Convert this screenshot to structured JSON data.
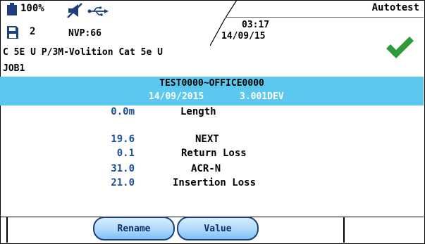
{
  "status": {
    "battery_percent": "100%",
    "memory_count": "2",
    "nvp": "NVP:66",
    "time": "03:17",
    "date": "14/09/15",
    "mode": "Autotest",
    "icons": [
      "battery-icon",
      "floppy-icon",
      "mute-icon",
      "usb-icon",
      "check-icon"
    ],
    "check_color": "#2e9b3a"
  },
  "cable_type": "C 5E U P/3M-Volition Cat 5e U",
  "job": "JOB1",
  "banner": {
    "title": "TEST0000~OFFICE0000",
    "date": "14/09/2015",
    "device": "3.001DEV",
    "color": "#5bc8f0"
  },
  "results": [
    {
      "value": "0.0m",
      "label": "Length"
    },
    {
      "value": "19.6",
      "label": "NEXT"
    },
    {
      "value": "0.1",
      "label": "Return Loss"
    },
    {
      "value": "31.0",
      "label": "ACR-N"
    },
    {
      "value": "21.0",
      "label": "Insertion Loss"
    }
  ],
  "softkeys": [
    "Rename",
    "Value"
  ]
}
